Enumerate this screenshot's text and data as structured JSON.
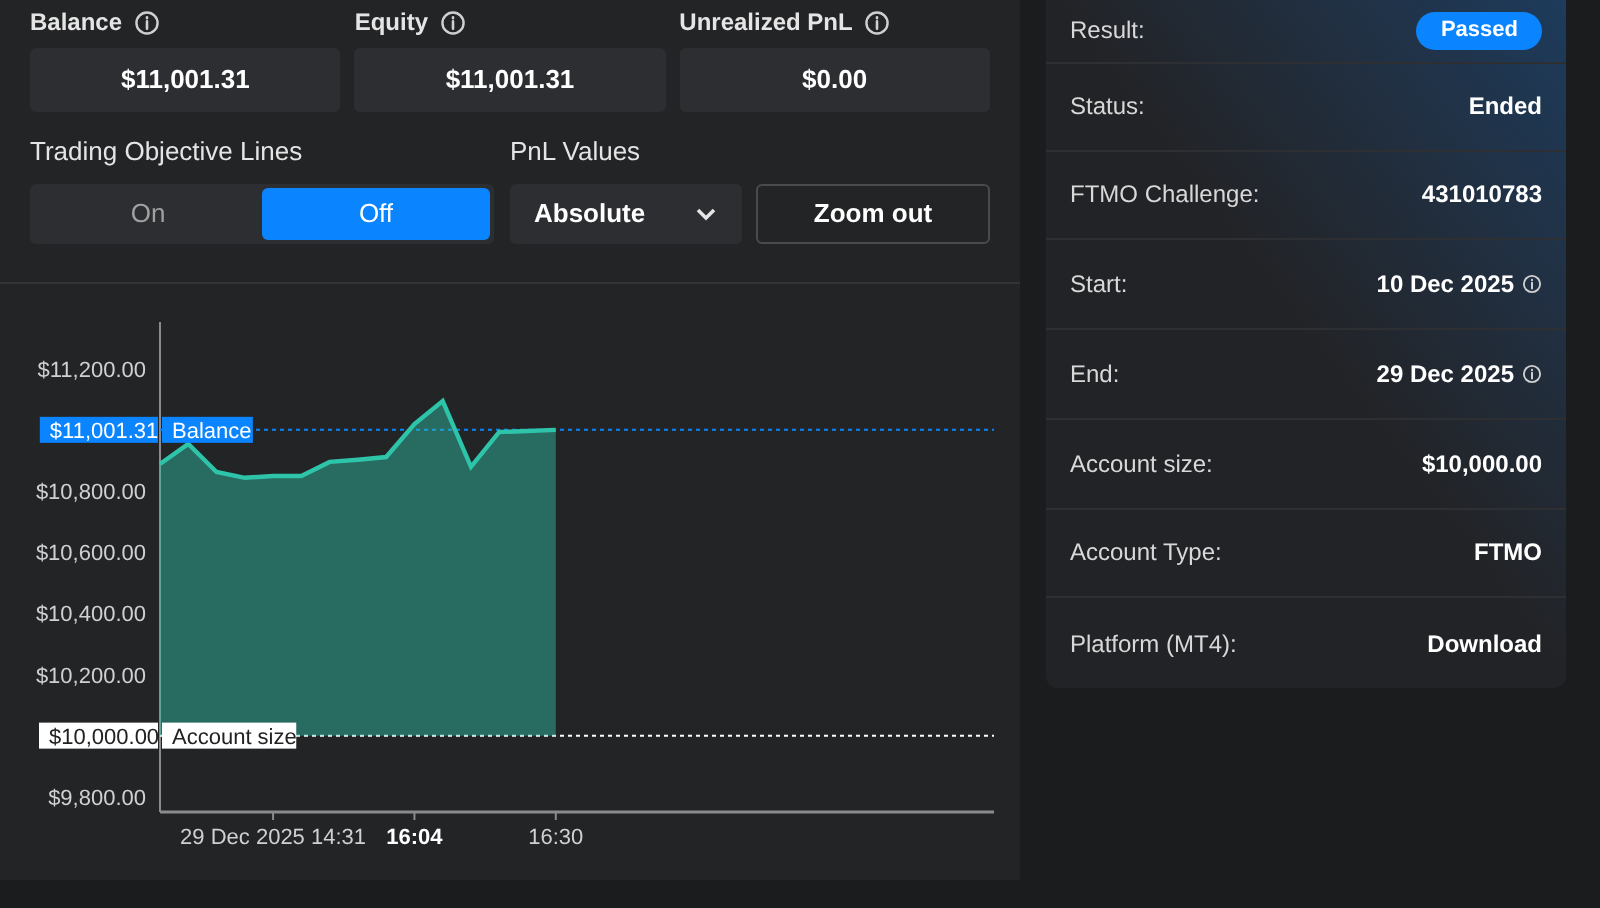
{
  "stats": [
    {
      "label": "Balance",
      "value": "$11,001.31"
    },
    {
      "label": "Equity",
      "value": "$11,001.31"
    },
    {
      "label": "Unrealized PnL",
      "value": "$0.00"
    }
  ],
  "objective_lines": {
    "label": "Trading Objective Lines",
    "options": [
      {
        "label": "On",
        "selected": false
      },
      {
        "label": "Off",
        "selected": true
      }
    ]
  },
  "pnl_values": {
    "label": "PnL Values",
    "value": "Absolute"
  },
  "zoom_button": "Zoom out",
  "chart": {
    "ref_line_values": [
      "$11,001.31",
      "$10,000.00"
    ],
    "chart_data": {
      "type": "area",
      "ylim": [
        9750,
        11354
      ],
      "categories": [
        null,
        null,
        null,
        null,
        "29 Dec 2025 14:31",
        null,
        null,
        null,
        null,
        "16:04",
        null,
        null,
        null,
        null,
        "16:30"
      ],
      "series": [
        {
          "name": "Balance",
          "color": "#2ec4a9",
          "values": [
            10889,
            10955,
            10863,
            10844,
            10850,
            10850,
            10896,
            10903,
            10912,
            11020,
            11095,
            10880,
            10994,
            10997,
            11001
          ]
        }
      ],
      "yticks": [
        {
          "value": 9800,
          "label": "$9,800.00"
        },
        {
          "value": 10200,
          "label": "$10,200.00"
        },
        {
          "value": 10400,
          "label": "$10,400.00"
        },
        {
          "value": 10600,
          "label": "$10,600.00"
        },
        {
          "value": 10800,
          "label": "$10,800.00"
        },
        {
          "value": 11200,
          "label": "$11,200.00"
        }
      ],
      "ref_lines": [
        {
          "axis": "y",
          "value": 11001,
          "color": "#0a84ff"
        },
        {
          "axis": "y",
          "value": 10000,
          "label": "Account size",
          "color": "#ffffff"
        }
      ]
    }
  },
  "details": [
    {
      "label": "Result:",
      "value": "Passed",
      "kind": "badge",
      "info": false
    },
    {
      "label": "Status:",
      "value": "Ended",
      "kind": "text",
      "info": false
    },
    {
      "label": "FTMO Challenge:",
      "value": "431010783",
      "kind": "text",
      "info": false
    },
    {
      "label": "Start:",
      "value": "10 Dec 2025",
      "kind": "text",
      "info": true
    },
    {
      "label": "End:",
      "value": "29 Dec 2025",
      "kind": "text",
      "info": true
    },
    {
      "label": "Account size:",
      "value": "$10,000.00",
      "kind": "text",
      "info": false
    },
    {
      "label": "Account Type:",
      "value": "FTMO",
      "kind": "text",
      "info": false
    },
    {
      "label": "Platform (MT4):",
      "value": "Download",
      "kind": "link",
      "info": false
    }
  ]
}
